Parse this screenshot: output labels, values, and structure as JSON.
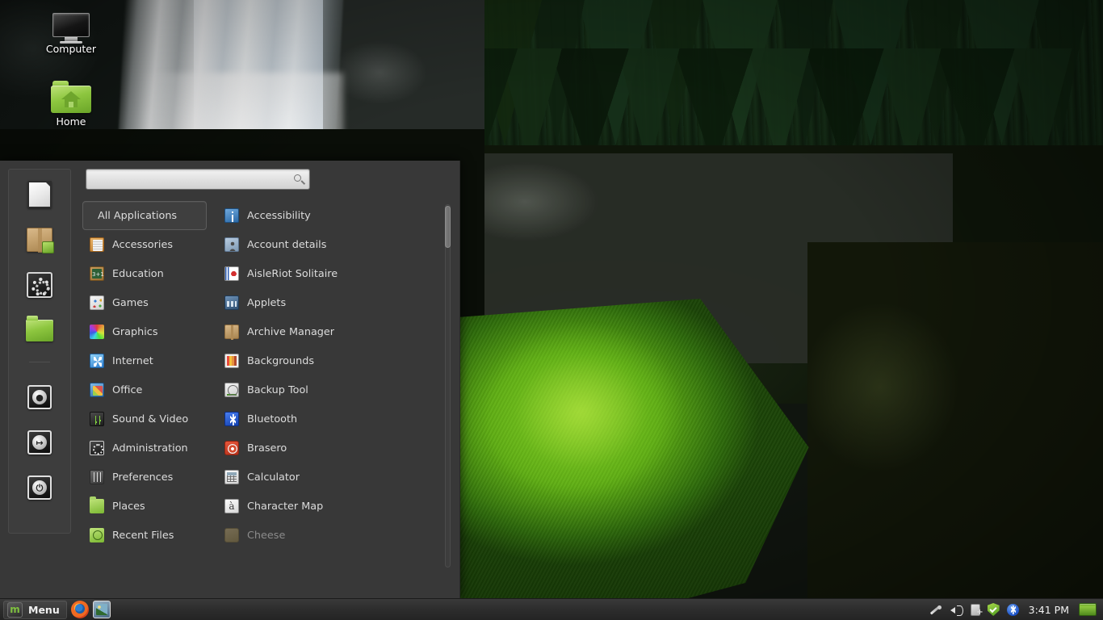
{
  "desktop": {
    "icons": [
      {
        "label": "Computer",
        "icon": "computer-icon"
      },
      {
        "label": "Home",
        "icon": "home-folder-icon"
      }
    ]
  },
  "menu": {
    "search": {
      "value": "",
      "placeholder": "",
      "icon": "search-icon"
    },
    "favorites": [
      {
        "name": "libreoffice-writer",
        "icon": "document-icon"
      },
      {
        "name": "software-manager",
        "icon": "package-icon"
      },
      {
        "name": "system-settings",
        "icon": "gears-icon"
      },
      {
        "name": "files",
        "icon": "folder-icon"
      },
      {
        "name": "lock-screen",
        "icon": "lock-icon",
        "glyph": "●"
      },
      {
        "name": "log-out",
        "icon": "logout-icon",
        "glyph": "↦"
      },
      {
        "name": "quit",
        "icon": "power-icon",
        "glyph": "⏻"
      }
    ],
    "categories": [
      {
        "label": "All Applications",
        "icon": "",
        "selected": true
      },
      {
        "label": "Accessories",
        "icon": "accessories-icon",
        "selected": false
      },
      {
        "label": "Education",
        "icon": "education-icon",
        "selected": false
      },
      {
        "label": "Games",
        "icon": "games-icon",
        "selected": false
      },
      {
        "label": "Graphics",
        "icon": "graphics-icon",
        "selected": false
      },
      {
        "label": "Internet",
        "icon": "internet-icon",
        "selected": false
      },
      {
        "label": "Office",
        "icon": "office-icon",
        "selected": false
      },
      {
        "label": "Sound & Video",
        "icon": "sound-video-icon",
        "selected": false
      },
      {
        "label": "Administration",
        "icon": "administration-icon",
        "selected": false
      },
      {
        "label": "Preferences",
        "icon": "preferences-icon",
        "selected": false
      },
      {
        "label": "Places",
        "icon": "places-icon",
        "selected": false
      },
      {
        "label": "Recent Files",
        "icon": "recent-files-icon",
        "selected": false
      }
    ],
    "applications": [
      {
        "label": "Accessibility",
        "icon": "accessibility-icon",
        "dimmed": false
      },
      {
        "label": "Account details",
        "icon": "account-details-icon",
        "dimmed": false
      },
      {
        "label": "AisleRiot Solitaire",
        "icon": "solitaire-icon",
        "dimmed": false
      },
      {
        "label": "Applets",
        "icon": "applets-icon",
        "dimmed": false
      },
      {
        "label": "Archive Manager",
        "icon": "archive-manager-icon",
        "dimmed": false
      },
      {
        "label": "Backgrounds",
        "icon": "backgrounds-icon",
        "dimmed": false
      },
      {
        "label": "Backup Tool",
        "icon": "backup-tool-icon",
        "dimmed": false
      },
      {
        "label": "Bluetooth",
        "icon": "bluetooth-icon",
        "dimmed": false
      },
      {
        "label": "Brasero",
        "icon": "brasero-icon",
        "dimmed": false
      },
      {
        "label": "Calculator",
        "icon": "calculator-icon",
        "dimmed": false
      },
      {
        "label": "Character Map",
        "icon": "character-map-icon",
        "dimmed": false
      },
      {
        "label": "Cheese",
        "icon": "cheese-icon",
        "dimmed": true
      }
    ]
  },
  "taskbar": {
    "menu_label": "Menu",
    "logo_glyph": "m",
    "launchers": [
      {
        "name": "firefox-launcher"
      },
      {
        "name": "image-viewer-launcher"
      }
    ],
    "tray": [
      {
        "name": "input-device-icon"
      },
      {
        "name": "volume-icon"
      },
      {
        "name": "removable-media-icon"
      },
      {
        "name": "update-manager-icon"
      },
      {
        "name": "bluetooth-icon"
      }
    ],
    "clock": "3:41 PM",
    "show_desktop": "show-desktop-button"
  },
  "colors": {
    "panel_bg": "#383838",
    "accent_green": "#8dc63f",
    "text": "#dcdcdc",
    "taskbar_bg": "#2e2e2e"
  }
}
